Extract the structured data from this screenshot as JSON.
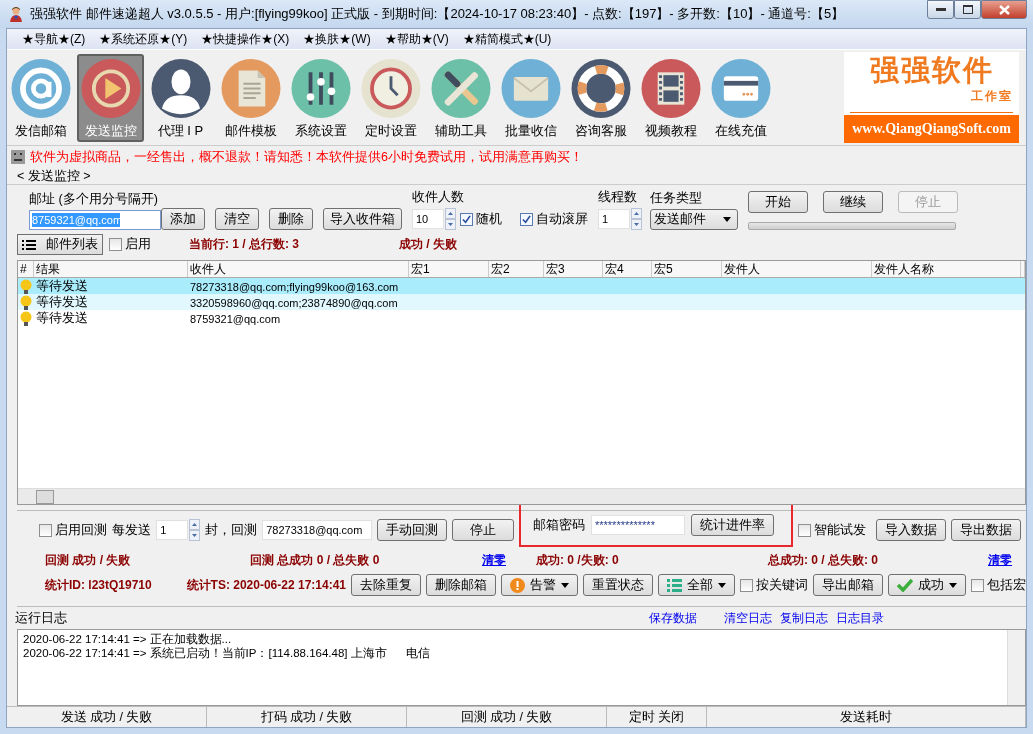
{
  "window": {
    "title": "强强软件 邮件速递超人 v3.0.5.5 - 用户:[flying99koo] 正式版 - 到期时间:【2024-10-17 08:23:40】- 点数:【197】- 多开数:【10】- 通道号:【5】"
  },
  "menu": [
    "★导航★(Z)",
    "★系统还原★(Y)",
    "★快捷操作★(X)",
    "★换肤★(W)",
    "★帮助★(V)",
    "★精简模式★(U)"
  ],
  "toolbar": [
    {
      "label": "发信邮箱",
      "kind": "at",
      "selected": false
    },
    {
      "label": "发送监控",
      "kind": "play",
      "selected": true
    },
    {
      "label": "代理 I P",
      "kind": "person",
      "selected": false
    },
    {
      "label": "邮件模板",
      "kind": "document",
      "selected": false
    },
    {
      "label": "系统设置",
      "kind": "sliders",
      "selected": false
    },
    {
      "label": "定时设置",
      "kind": "clock",
      "selected": false
    },
    {
      "label": "辅助工具",
      "kind": "tools",
      "selected": false
    },
    {
      "label": "批量收信",
      "kind": "mail",
      "selected": false
    },
    {
      "label": "咨询客服",
      "kind": "lifebuoy",
      "selected": false
    },
    {
      "label": "视频教程",
      "kind": "film",
      "selected": false
    },
    {
      "label": "在线充值",
      "kind": "card",
      "selected": false
    }
  ],
  "logo": {
    "title": "强强软件",
    "subtitle": "工作室",
    "url": "www.QiangQiangSoft.com"
  },
  "notice": "软件为虚拟商品，一经售出，概不退款！请知悉！本软件提供6小时免费试用，试用满意再购买！",
  "group_title": "< 发送监控 >",
  "send_form": {
    "address_label": "邮址 (多个用分号隔开)",
    "address_value": "8759321@qq.com",
    "buttons": [
      "添加",
      "清空",
      "删除"
    ],
    "import_button": "导入收件箱",
    "recipients_label": "收件人数",
    "recipients_value": "10",
    "random": {
      "label": "随机",
      "checked": true
    },
    "autoscroll": {
      "label": "自动滚屏",
      "checked": true
    },
    "threads_label": "线程数",
    "threads_value": "1",
    "task_label": "任务类型",
    "task_value": "发送邮件",
    "actions": [
      {
        "label": "开始",
        "disabled": false
      },
      {
        "label": "继续",
        "disabled": false
      },
      {
        "label": "停止",
        "disabled": true
      }
    ],
    "progress": {
      "level": 0
    }
  },
  "list_bar": {
    "button": "邮件列表",
    "enable": {
      "label": "启用",
      "checked": false
    },
    "position": "当前行: 1 / 总行数: 3",
    "result": "成功 / 失败"
  },
  "table": {
    "columns": [
      "#",
      "结果",
      "收件人",
      "宏1",
      "宏2",
      "宏3",
      "宏4",
      "宏5",
      "发件人",
      "发件人名称"
    ],
    "rows": [
      {
        "status": "等待发送",
        "recipient": "78273318@qq.com;flying99koo@163.com",
        "selected": true
      },
      {
        "status": "等待发送",
        "recipient": "3320598960@qq.com;23874890@qq.com",
        "selected": false
      },
      {
        "status": "等待发送",
        "recipient": "8759321@qq.com",
        "selected": false
      }
    ]
  },
  "check_panel": {
    "enable": {
      "label": "启用回测",
      "checked": false
    },
    "every_label": "每发送",
    "every_value": "1",
    "unit_label": "封，回测",
    "check_address": "78273318@qq.com",
    "manual_button": "手动回测",
    "stop_button": "停止",
    "password_label": "邮箱密码",
    "password_value": "**************",
    "rate_button": "统计进件率",
    "smart": {
      "label": "智能试发",
      "checked": false
    },
    "import_button": "导入数据",
    "export_button": "导出数据",
    "check_result": "回测 成功 / 失败",
    "check_total": "回测 总成功 0 / 总失败 0",
    "clear_link": "清零",
    "result": "成功: 0 /失败: 0",
    "total": "总成功: 0 / 总失败: 0",
    "clear_link_2": "清零",
    "stat_id": "统计ID: l23tQ19710",
    "stat_ts": "统计TS: 2020-06-22 17:14:41",
    "dedupe_button": "去除重复",
    "delete_button": "删除邮箱",
    "alarm_dropdown": "告警",
    "reset_button": "重置状态",
    "filter_dropdown": "全部",
    "keyword": {
      "label": "按关键词",
      "checked": false
    },
    "export_mail_button": "导出邮箱",
    "status_dropdown": "成功",
    "macro": {
      "label": "包括宏",
      "checked": false
    }
  },
  "log": {
    "title": "运行日志",
    "links": [
      "保存数据",
      "清空日志",
      "复制日志",
      "日志目录"
    ],
    "lines": [
      "2020-06-22 17:14:41 => 正在加载数据...",
      "2020-06-22 17:14:41 => 系统已启动！当前IP：[114.88.164.48] 上海市      电信"
    ]
  },
  "status_bar": [
    "发送 成功 / 失败",
    "打码 成功 / 失败",
    "回测 成功 / 失败",
    "定时 关闭",
    "发送耗时"
  ]
}
